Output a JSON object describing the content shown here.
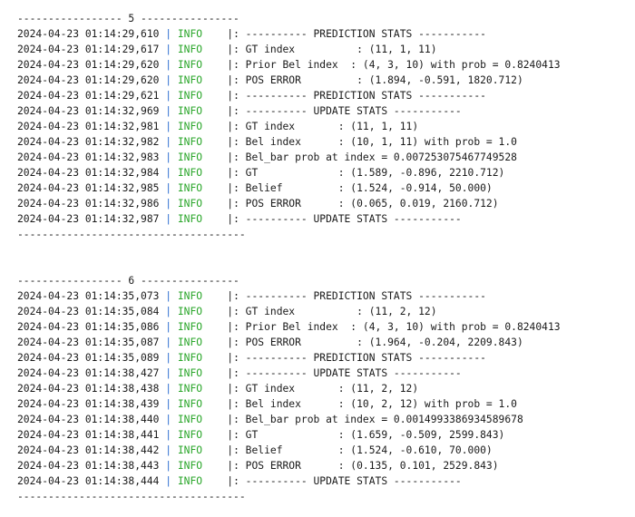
{
  "blocks": [
    {
      "header": "----------------- 5 ----------------",
      "lines": [
        {
          "ts": "2024-04-23 01:14:29,610",
          "level": "INFO",
          "msg": "|: ---------- PREDICTION STATS -----------"
        },
        {
          "ts": "2024-04-23 01:14:29,617",
          "level": "INFO",
          "msg": "|: GT index          : (11, 1, 11)"
        },
        {
          "ts": "2024-04-23 01:14:29,620",
          "level": "INFO",
          "msg": "|: Prior Bel index  : (4, 3, 10) with prob = 0.8240413"
        },
        {
          "ts": "2024-04-23 01:14:29,620",
          "level": "INFO",
          "msg": "|: POS ERROR         : (1.894, -0.591, 1820.712)"
        },
        {
          "ts": "2024-04-23 01:14:29,621",
          "level": "INFO",
          "msg": "|: ---------- PREDICTION STATS -----------"
        },
        {
          "ts": "2024-04-23 01:14:32,969",
          "level": "INFO",
          "msg": "|: ---------- UPDATE STATS -----------"
        },
        {
          "ts": "2024-04-23 01:14:32,981",
          "level": "INFO",
          "msg": "|: GT index       : (11, 1, 11)"
        },
        {
          "ts": "2024-04-23 01:14:32,982",
          "level": "INFO",
          "msg": "|: Bel index      : (10, 1, 11) with prob = 1.0"
        },
        {
          "ts": "2024-04-23 01:14:32,983",
          "level": "INFO",
          "msg": "|: Bel_bar prob at index = 0.007253075467749528"
        },
        {
          "ts": "2024-04-23 01:14:32,984",
          "level": "INFO",
          "msg": "|: GT             : (1.589, -0.896, 2210.712)"
        },
        {
          "ts": "2024-04-23 01:14:32,985",
          "level": "INFO",
          "msg": "|: Belief         : (1.524, -0.914, 50.000)"
        },
        {
          "ts": "2024-04-23 01:14:32,986",
          "level": "INFO",
          "msg": "|: POS ERROR      : (0.065, 0.019, 2160.712)"
        },
        {
          "ts": "2024-04-23 01:14:32,987",
          "level": "INFO",
          "msg": "|: ---------- UPDATE STATS -----------"
        }
      ],
      "footer": "-------------------------------------"
    },
    {
      "header": "----------------- 6 ----------------",
      "lines": [
        {
          "ts": "2024-04-23 01:14:35,073",
          "level": "INFO",
          "msg": "|: ---------- PREDICTION STATS -----------"
        },
        {
          "ts": "2024-04-23 01:14:35,084",
          "level": "INFO",
          "msg": "|: GT index          : (11, 2, 12)"
        },
        {
          "ts": "2024-04-23 01:14:35,086",
          "level": "INFO",
          "msg": "|: Prior Bel index  : (4, 3, 10) with prob = 0.8240413"
        },
        {
          "ts": "2024-04-23 01:14:35,087",
          "level": "INFO",
          "msg": "|: POS ERROR         : (1.964, -0.204, 2209.843)"
        },
        {
          "ts": "2024-04-23 01:14:35,089",
          "level": "INFO",
          "msg": "|: ---------- PREDICTION STATS -----------"
        },
        {
          "ts": "2024-04-23 01:14:38,427",
          "level": "INFO",
          "msg": "|: ---------- UPDATE STATS -----------"
        },
        {
          "ts": "2024-04-23 01:14:38,438",
          "level": "INFO",
          "msg": "|: GT index       : (11, 2, 12)"
        },
        {
          "ts": "2024-04-23 01:14:38,439",
          "level": "INFO",
          "msg": "|: Bel index      : (10, 2, 12) with prob = 1.0"
        },
        {
          "ts": "2024-04-23 01:14:38,440",
          "level": "INFO",
          "msg": "|: Bel_bar prob at index = 0.0014993386934589678"
        },
        {
          "ts": "2024-04-23 01:14:38,441",
          "level": "INFO",
          "msg": "|: GT             : (1.659, -0.509, 2599.843)"
        },
        {
          "ts": "2024-04-23 01:14:38,442",
          "level": "INFO",
          "msg": "|: Belief         : (1.524, -0.610, 70.000)"
        },
        {
          "ts": "2024-04-23 01:14:38,443",
          "level": "INFO",
          "msg": "|: POS ERROR      : (0.135, 0.101, 2529.843)"
        },
        {
          "ts": "2024-04-23 01:14:38,444",
          "level": "INFO",
          "msg": "|: ---------- UPDATE STATS -----------"
        }
      ],
      "footer": "-------------------------------------"
    }
  ],
  "colors": {
    "text": "#1a1a1a",
    "separator": "#2e6fd0",
    "level_info": "#2aa62a",
    "background": "#ffffff"
  }
}
